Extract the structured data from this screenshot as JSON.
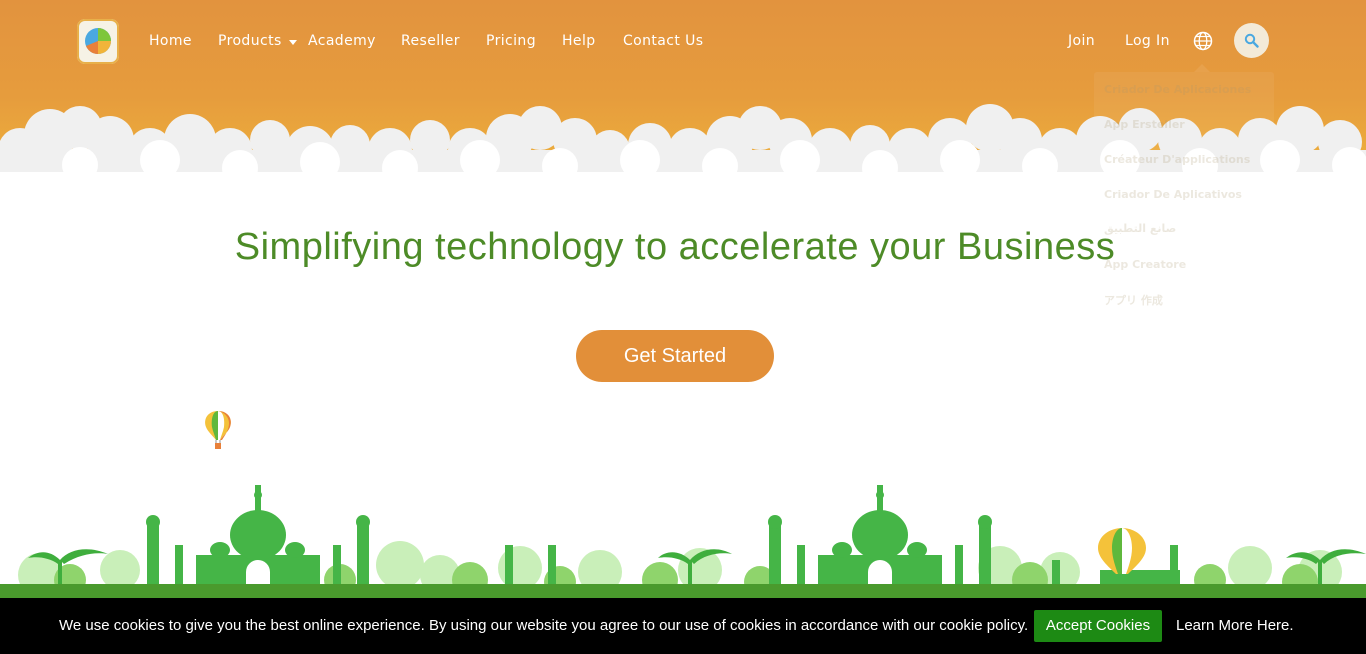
{
  "nav": {
    "items": [
      {
        "label": "Home"
      },
      {
        "label": "Products"
      },
      {
        "label": "Academy"
      },
      {
        "label": "Reseller"
      },
      {
        "label": "Pricing"
      },
      {
        "label": "Help"
      },
      {
        "label": "Contact Us"
      }
    ],
    "join": "Join",
    "login": "Log In",
    "globe_icon": "globe-icon",
    "search_icon": "search-icon"
  },
  "language_menu": {
    "items": [
      "Criador De Aplicaciones",
      "App Ersteller",
      "Créateur D'applications",
      "Criador De Aplicativos",
      "صانع التطبيق",
      "App Creatore",
      "アプリ 作成"
    ]
  },
  "hero": {
    "title": "Simplifying technology to accelerate your Business",
    "cta": "Get Started"
  },
  "cookie": {
    "message": "We use cookies to give you the best online experience. By using our website you agree to our use of cookies in accordance with our cookie policy.",
    "accept": "Accept Cookies",
    "learn_more": "Learn More Here."
  },
  "colors": {
    "header": "#e69c3d",
    "brand_green": "#4d8b27",
    "cta": "#e28f39",
    "accept": "#1d8a14",
    "cookie_bg": "#000000"
  }
}
